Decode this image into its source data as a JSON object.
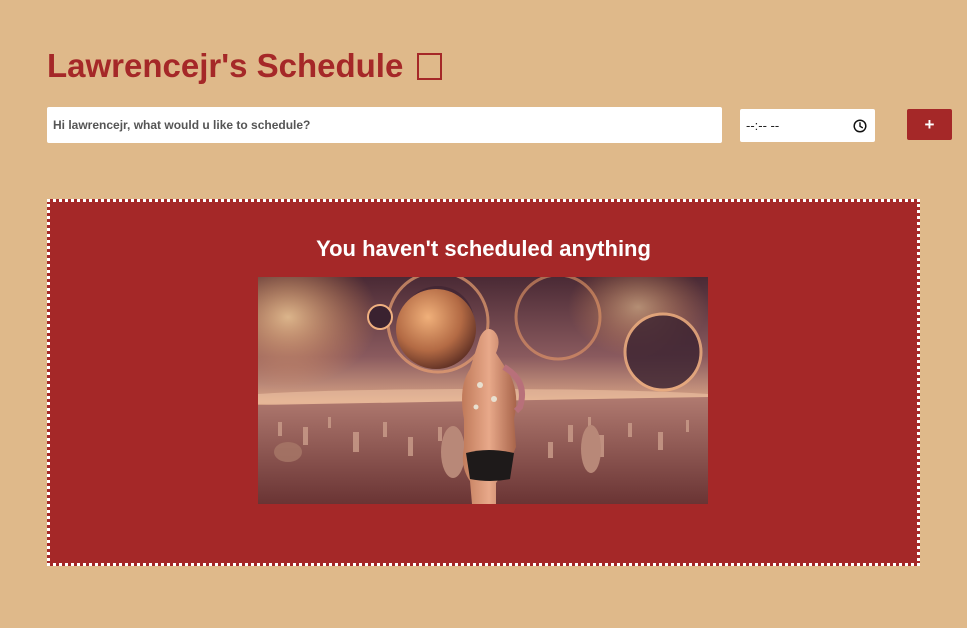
{
  "header": {
    "title": "Lawrencejr's Schedule"
  },
  "form": {
    "task_placeholder": "Hi lawrencejr, what would u like to schedule?",
    "time_value": "--:-- --",
    "add_label": "+"
  },
  "schedule": {
    "empty_message": "You haven't scheduled anything"
  },
  "colors": {
    "background": "#dfb98a",
    "accent": "#a52828",
    "panel_border": "#ffffff"
  },
  "icons": {
    "title_box": "empty-box-icon",
    "time": "clock-icon"
  }
}
